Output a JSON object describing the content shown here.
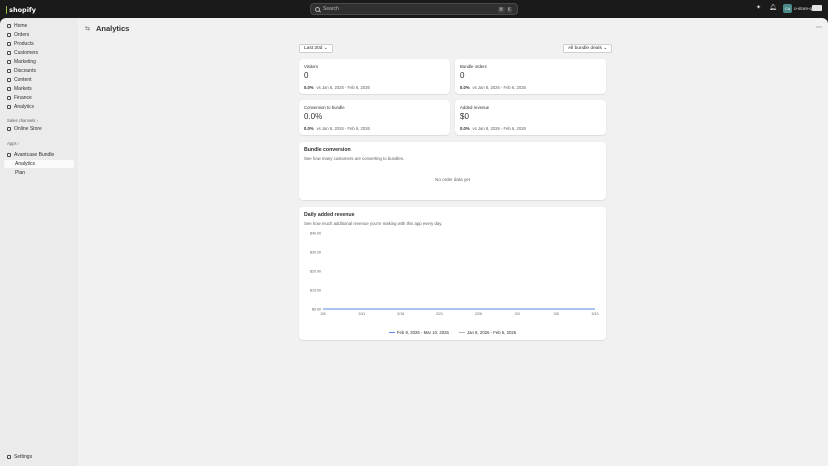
{
  "topbar": {
    "logo_text": "shopify",
    "search_placeholder": "Search",
    "shortcut_key1": "⌘",
    "shortcut_key2": "K",
    "avatar_initials": "Cd",
    "store_name": "o-store-qa"
  },
  "sidebar": {
    "items": [
      {
        "label": "Home",
        "icon": "home-icon"
      },
      {
        "label": "Orders",
        "icon": "orders-icon"
      },
      {
        "label": "Products",
        "icon": "tag-icon"
      },
      {
        "label": "Customers",
        "icon": "person-icon"
      },
      {
        "label": "Marketing",
        "icon": "target-icon"
      },
      {
        "label": "Discounts",
        "icon": "discount-icon"
      },
      {
        "label": "Content",
        "icon": "content-icon"
      },
      {
        "label": "Markets",
        "icon": "globe-icon"
      },
      {
        "label": "Finance",
        "icon": "bank-icon"
      },
      {
        "label": "Analytics",
        "icon": "chart-icon"
      }
    ],
    "sales_channels_label": "Sales channels",
    "online_store_label": "Online Store",
    "apps_label": "Apps",
    "app_name": "Avantcase Bundle",
    "app_sub_items": [
      "Analytics",
      "Plan"
    ],
    "settings_label": "Settings"
  },
  "page": {
    "title": "Analytics",
    "date_button": "Last 30d",
    "filter_button": "All bundle deals"
  },
  "metrics": [
    {
      "label": "Visitors",
      "value": "0",
      "pct": "0.0%",
      "compare": "vs Jan 8, 2026 - Feb 6, 2026"
    },
    {
      "label": "Bundle orders",
      "value": "0",
      "pct": "0.0%",
      "compare": "vs Jan 8, 2026 - Feb 6, 2026"
    },
    {
      "label": "Conversion to bundle",
      "value": "0.0%",
      "pct": "0.0%",
      "compare": "vs Jan 8, 2026 - Feb 6, 2026"
    },
    {
      "label": "Added revenue",
      "value": "$0",
      "pct": "0.0%",
      "compare": "vs Jan 8, 2026 - Feb 6, 2026"
    }
  ],
  "bundle_conversion": {
    "title": "Bundle conversion",
    "subtitle": "See how many customers are converting to bundles.",
    "empty_text": "No order data yet"
  },
  "daily_revenue": {
    "title": "Daily added revenue",
    "subtitle": "See how much additional revenue you're making with this app every day."
  },
  "chart_data": {
    "type": "line",
    "x": [
      "2/6",
      "2/11",
      "2/16",
      "2/21",
      "2/26",
      "3/3",
      "3/8",
      "3/13"
    ],
    "y_ticks": [
      "$0.00",
      "$10.00",
      "$20.00",
      "$30.00",
      "$40.00"
    ],
    "ylim": [
      0,
      40
    ],
    "series": [
      {
        "name": "Feb 8, 2026 - Mar 10, 2026",
        "values": [
          0,
          0,
          0,
          0,
          0,
          0,
          0,
          0
        ],
        "color": "#4f8ee8",
        "style": "solid"
      },
      {
        "name": "Jan 8, 2026 - Feb 6, 2026",
        "values": [
          0,
          0,
          0,
          0,
          0,
          0,
          0,
          0
        ],
        "color": "#b5b5b5",
        "style": "dashed"
      }
    ],
    "grid": false,
    "legend": "bottom"
  }
}
